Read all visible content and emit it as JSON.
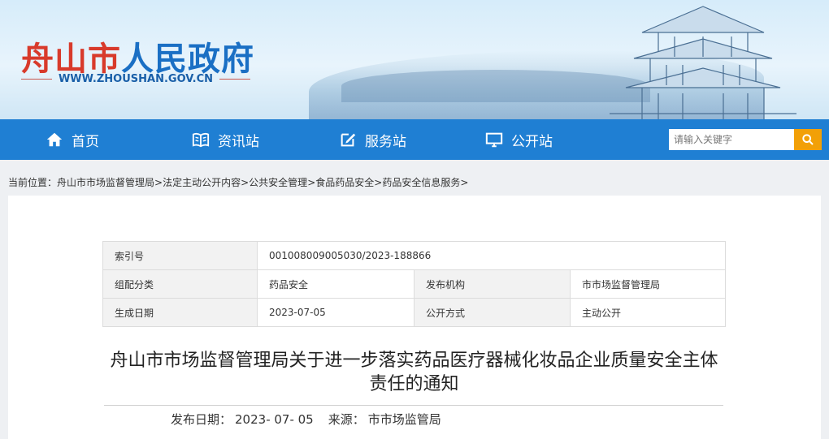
{
  "header": {
    "title_part1": "舟山市",
    "title_part2": "人民政府",
    "url": "WWW.ZHOUSHAN.GOV.CN"
  },
  "nav": {
    "items": [
      {
        "label": "首页",
        "icon": "home-icon"
      },
      {
        "label": "资讯站",
        "icon": "book-icon"
      },
      {
        "label": "服务站",
        "icon": "edit-icon"
      },
      {
        "label": "公开站",
        "icon": "monitor-icon"
      }
    ],
    "search_placeholder": "请输入关键字"
  },
  "breadcrumb": {
    "prefix": "当前位置：",
    "items": [
      "舟山市市场监督管理局",
      "法定主动公开内容",
      "公共安全管理",
      "食品药品安全",
      "药品安全信息服务"
    ],
    "separator": ">"
  },
  "meta": {
    "index_label": "索引号",
    "index_value": "001008009005030/2023-188866",
    "category_label": "组配分类",
    "category_value": "药品安全",
    "publisher_label": "发布机构",
    "publisher_value": "市市场监督管理局",
    "date_label": "生成日期",
    "date_value": "2023-07-05",
    "mode_label": "公开方式",
    "mode_value": "主动公开"
  },
  "article": {
    "title": "舟山市市场监督管理局关于进一步落实药品医疗器械化妆品企业质量安全主体责任的通知",
    "pub_date_label": "发布日期：",
    "pub_date": "2023- 07- 05",
    "source_label": "来源：",
    "source": "市市场监管局"
  },
  "colors": {
    "nav_bg": "#1f7fd3",
    "title_red": "#d83a2b",
    "title_blue": "#1a6fc4",
    "search_button": "#f2a007"
  }
}
